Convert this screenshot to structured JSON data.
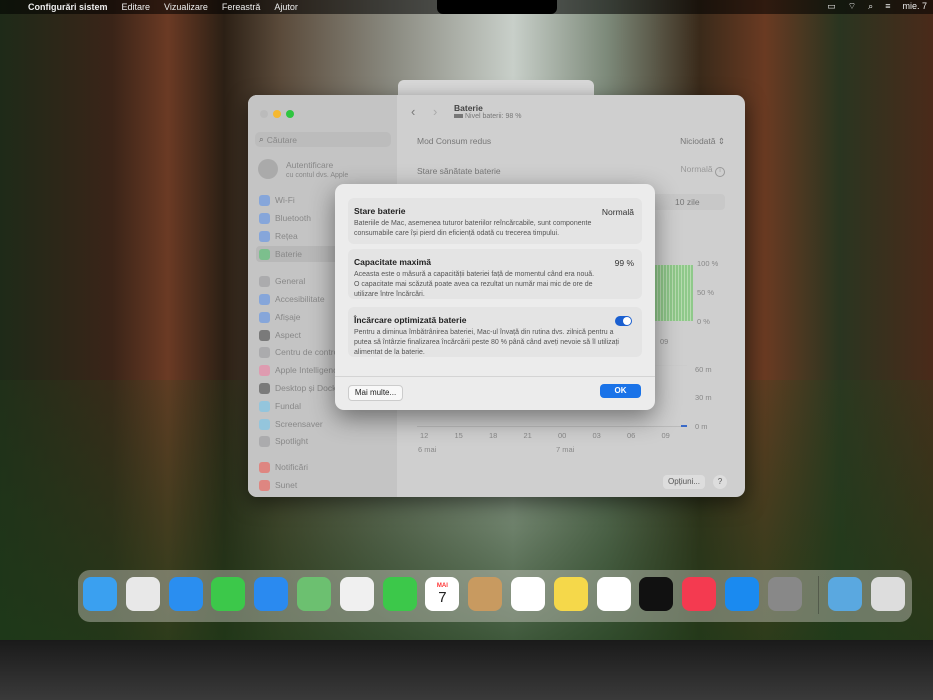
{
  "menubar": {
    "app": "Configurări sistem",
    "items": [
      "Editare",
      "Vizualizare",
      "Fereastră",
      "Ajutor"
    ],
    "clock": "mie. 7"
  },
  "sidebar": {
    "search_placeholder": "Căutare",
    "account_title": "Autentificare",
    "account_sub": "cu contul dvs. Apple",
    "items": [
      {
        "label": "Wi-Fi",
        "color": "#3b82f6"
      },
      {
        "label": "Bluetooth",
        "color": "#3b82f6"
      },
      {
        "label": "Rețea",
        "color": "#3b82f6"
      },
      {
        "label": "Baterie",
        "color": "#34c759"
      },
      {
        "label": "General",
        "color": "#8e8e93"
      },
      {
        "label": "Accesibilitate",
        "color": "#3b82f6"
      },
      {
        "label": "Afișaje",
        "color": "#3b82f6"
      },
      {
        "label": "Aspect",
        "color": "#222"
      },
      {
        "label": "Centru de control",
        "color": "#8e8e93"
      },
      {
        "label": "Apple Intelligence",
        "color": "#ff6b9a"
      },
      {
        "label": "Desktop și Dock",
        "color": "#222"
      },
      {
        "label": "Fundal",
        "color": "#5ac8fa"
      },
      {
        "label": "Screensaver",
        "color": "#5ac8fa"
      },
      {
        "label": "Spotlight",
        "color": "#8e8e93"
      },
      {
        "label": "Notificări",
        "color": "#ff3b30"
      },
      {
        "label": "Sunet",
        "color": "#ff3b30"
      }
    ]
  },
  "main": {
    "title": "Baterie",
    "subtitle": "Nivel baterii: 98 %",
    "low_power_label": "Mod Consum redus",
    "low_power_value": "Niciodată",
    "health_label": "Stare sănătate baterie",
    "health_value": "Normală",
    "range_tab": "10 zile",
    "chart_level_ticks": [
      "100 %",
      "50 %",
      "0 %"
    ],
    "chart_usage_ticks": [
      "60 m",
      "30 m",
      "0 m"
    ],
    "x_ticks": [
      "12",
      "15",
      "18",
      "21",
      "00",
      "03",
      "06",
      "09"
    ],
    "x_partial": "09",
    "dates": [
      "6 mai",
      "7 mai"
    ],
    "options_button": "Opțiuni...",
    "help_button": "?"
  },
  "dialog": {
    "cards": [
      {
        "title": "Stare baterie",
        "value": "Normală",
        "desc": "Bateriile de Mac, asemenea tuturor bateriilor reîncărcabile, sunt componente consumabile care își pierd din eficiență odată cu trecerea timpului."
      },
      {
        "title": "Capacitate maximă",
        "value": "99 %",
        "desc": "Aceasta este o măsură a capacității bateriei față de momentul când era nouă. O capacitate mai scăzută poate avea ca rezultat un număr mai mic de ore de utilizare între încărcări."
      },
      {
        "title": "Încărcare optimizată baterie",
        "toggle_on": true,
        "desc": "Pentru a diminua îmbătrânirea bateriei, Mac-ul învață din rutina dvs. zilnică pentru a putea să întârzie finalizarea încărcării peste 80 % până când aveți nevoie să îl utilizați alimentat de la baterie."
      }
    ],
    "more_button": "Mai multe...",
    "ok_button": "OK",
    "accent": "#1a73e8"
  },
  "dock": {
    "calendar_month": "MAI",
    "calendar_day": "7",
    "apps": [
      "finder",
      "launchpad",
      "safari",
      "messages",
      "mail",
      "maps",
      "photos",
      "facetime",
      "calendar",
      "contacts",
      "reminders",
      "notes",
      "freeform",
      "tv",
      "music",
      "app-store",
      "system-settings",
      "downloads",
      "trash"
    ]
  }
}
